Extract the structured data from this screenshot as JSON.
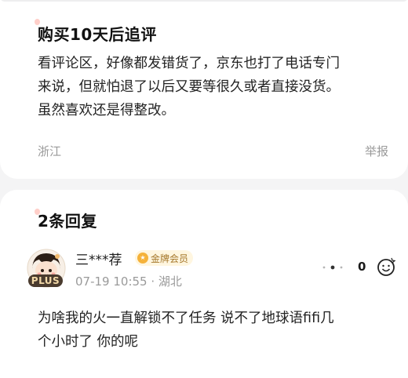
{
  "followup": {
    "title": "购买10天后追评",
    "lines": [
      "看评论区，好像都发错货了，京东也打了电话专门",
      "来说，但就怕退了以后又要等很久或者直接没货。",
      "虽然喜欢还是得整改。"
    ],
    "location": "浙江",
    "report_label": "举报"
  },
  "replies": {
    "title": "2条回复",
    "items": [
      {
        "badge": "PLUS",
        "username": "三***荐",
        "member_label": "金牌会员",
        "medal_glyph": "★",
        "timestamp": "07-19 10:55",
        "location": "· 湖北",
        "like_count": "0",
        "lines": [
          "为啥我的火一直解锁不了任务 说不了地球语fifi几",
          "个小时了 你的呢"
        ]
      }
    ]
  },
  "colors": {
    "background": "#f4f4f5",
    "card": "#ffffff",
    "accent_pink": "#ffcfc9",
    "meta_gray": "#9a9a9a",
    "gold": "#f5b23a"
  },
  "icons": [
    "more-dots-icon",
    "like-face-icon",
    "gold-medal-icon"
  ]
}
